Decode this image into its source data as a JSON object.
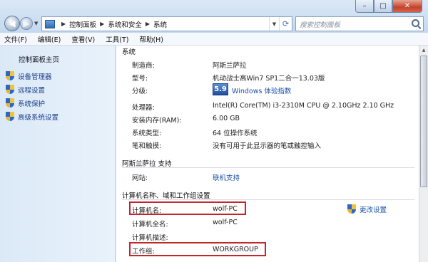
{
  "address": {
    "crumbs": [
      "控制面板",
      "系统和安全",
      "系统"
    ],
    "search_placeholder": "搜索控制面板"
  },
  "menubar": [
    "文件(F)",
    "编辑(E)",
    "查看(V)",
    "工具(T)",
    "帮助(H)"
  ],
  "sidebar": {
    "home": "控制面板主页",
    "links": [
      "设备管理器",
      "远程设置",
      "系统保护",
      "高级系统设置"
    ]
  },
  "system": {
    "section_title": "系统",
    "rows": [
      {
        "label": "制造商:",
        "value": "阿斯兰萨拉"
      },
      {
        "label": "型号:",
        "value": "机动战士高Win7 SP1二合一13.03版"
      },
      {
        "label": "分级:",
        "score": "5.9",
        "value": "Windows 体验指数"
      },
      {
        "label": "处理器:",
        "value": "Intel(R) Core(TM) i3-2310M CPU @ 2.10GHz   2.10 GHz"
      },
      {
        "label": "安装内存(RAM):",
        "value": "6.00 GB"
      },
      {
        "label": "系统类型:",
        "value": "64 位操作系统"
      },
      {
        "label": "笔和触摸:",
        "value": "没有可用于此显示器的笔或触控输入"
      }
    ]
  },
  "support": {
    "section_title": "阿斯兰萨拉 支持",
    "label": "网站:",
    "value": "联机支持"
  },
  "computer": {
    "section_title": "计算机名称、域和工作组设置",
    "change_label": "更改设置",
    "rows": [
      {
        "label": "计算机名:",
        "value": "wolf-PC"
      },
      {
        "label": "计算机全名:",
        "value": "wolf-PC"
      },
      {
        "label": "计算机描述:",
        "value": ""
      },
      {
        "label": "工作组:",
        "value": "WORKGROUP"
      }
    ]
  }
}
